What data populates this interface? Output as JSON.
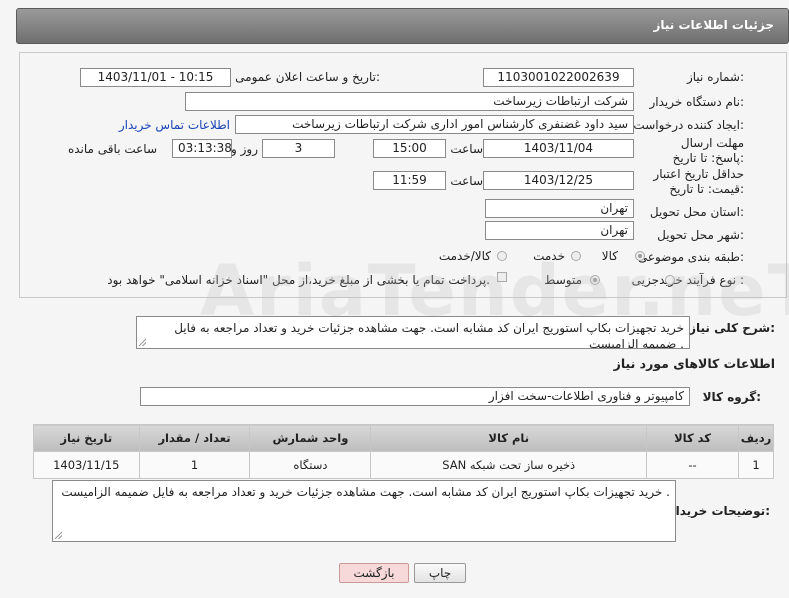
{
  "header": {
    "title": "جزئیات اطلاعات نیاز"
  },
  "form": {
    "need_number_label": "شماره نیاز:",
    "need_number": "1103001022002639",
    "announce_label": "تاریخ و ساعت اعلان عمومی:",
    "announce_value": "1403/11/01 - 10:15",
    "buyer_org_label": "نام دستگاه خریدار:",
    "buyer_org": "شرکت ارتباطات زیرساخت",
    "creator_label": "ایجاد کننده درخواست:",
    "creator": "سید داود غضنفری کارشناس امور اداری شرکت ارتباطات زیرساخت",
    "contact_link": "اطلاعات تماس خریدار",
    "deadline_label": "مهلت ارسال پاسخ: تا تاریخ:",
    "deadline_date": "1403/11/04",
    "time_label": "ساعت",
    "deadline_time": "15:00",
    "days_value": "3",
    "days_label": "روز و",
    "remaining_time": "03:13:38",
    "remaining_label": "ساعت باقی مانده",
    "price_validity_label": "حداقل تاریخ اعتبار قیمت: تا تاریخ:",
    "price_date": "1403/12/25",
    "price_time": "11:59",
    "province_label": "استان محل تحویل:",
    "province": "تهران",
    "city_label": "شهر محل تحویل:",
    "city": "تهران",
    "category_label": "طبقه بندی موضوعی:",
    "category_options": [
      "کالا",
      "خدمت",
      "کالا/خدمت"
    ],
    "process_label": "نوع فرآیند خرید :",
    "process_options": [
      "جزیی",
      "متوسط"
    ],
    "payment_note": "پرداخت تمام یا بخشی از مبلغ خرید،از محل \"اسناد خزانه اسلامی\" خواهد بود."
  },
  "summary": {
    "label": "شرح کلی نیاز:",
    "text": "خرید تجهیزات بکاپ استوریج ایران کد مشابه است. جهت مشاهده جزئیات خرید و تعداد مراجعه به فایل ضمیمه الزامیست ."
  },
  "goods": {
    "section_title": "اطلاعات کالاهای مورد نیاز",
    "group_label": "گروه کالا:",
    "group_value": "کامپیوتر و فناوری اطلاعات-سخت افزار",
    "columns": [
      "ردیف",
      "کد کالا",
      "نام کالا",
      "واحد شمارش",
      "تعداد / مقدار",
      "تاریخ نیاز"
    ],
    "rows": [
      [
        "1",
        "--",
        "ذخیره ساز تحت شبکه SAN",
        "دستگاه",
        "1",
        "1403/11/15"
      ]
    ]
  },
  "buyer_notes": {
    "label": "توضیحات خریدار:",
    "text": "خرید تجهیزات بکاپ استوریج ایران کد مشابه است. جهت مشاهده جزئیات خرید و تعداد مراجعه به فایل ضمیمه الزامیست ."
  },
  "buttons": {
    "print": "چاپ",
    "back": "بازگشت"
  },
  "watermark": "AriaTender.neT",
  "colors": {
    "header": "#7a7a7a",
    "link": "#1a44b8",
    "back_button": "#f7d9d9"
  }
}
